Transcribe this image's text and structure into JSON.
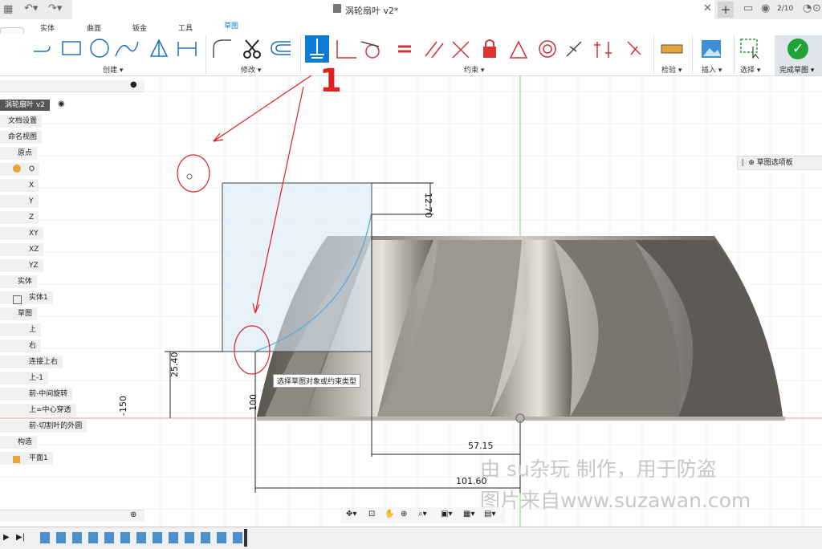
{
  "window": {
    "title": "涡轮扇叶 v2*",
    "page_counter": "2/10"
  },
  "tabs": [
    {
      "label": "实体"
    },
    {
      "label": "曲面"
    },
    {
      "label": "钣金"
    },
    {
      "label": "工具"
    },
    {
      "label": "草图"
    }
  ],
  "toolbar_groups": {
    "create": "创建 ▾",
    "modify": "修改 ▾",
    "constraints": "约束 ▾",
    "inspect": "检验 ▾",
    "insert": "插入 ▾",
    "select": "选择 ▾",
    "finish": "完成草图 ▾"
  },
  "browser": {
    "root": "涡轮扇叶 v2",
    "items": [
      {
        "label": "文档设置"
      },
      {
        "label": "命名视图"
      },
      {
        "label": "原点"
      },
      {
        "label": "O"
      },
      {
        "label": "X"
      },
      {
        "label": "Y"
      },
      {
        "label": "Z"
      },
      {
        "label": "XY"
      },
      {
        "label": "XZ"
      },
      {
        "label": "YZ"
      },
      {
        "label": "实体"
      },
      {
        "label": "实体1"
      },
      {
        "label": "草图"
      },
      {
        "label": "上"
      },
      {
        "label": "右"
      },
      {
        "label": "连接上右"
      },
      {
        "label": "上-1"
      },
      {
        "label": "前-中间旋转"
      },
      {
        "label": "上=中心穿透"
      },
      {
        "label": "前-切割叶的外圆"
      },
      {
        "label": "构造"
      },
      {
        "label": "平面1"
      }
    ]
  },
  "sketch_palette": "草图选项板",
  "tooltip": "选择草图对象或约束类型",
  "dimensions": {
    "d1": "12.70",
    "d2": "25.40",
    "d3": "-150",
    "d4": "100",
    "d5": "57.15",
    "d6": "101.60"
  },
  "annotation_number": "1",
  "watermark": {
    "line1": "由 su杂玩 制作，用于防盗",
    "line2": "图片来自www.suzawan.com"
  },
  "colors": {
    "accent": "#0a7bd6",
    "annotation": "#e0201f",
    "finish_green": "#22a33a"
  }
}
